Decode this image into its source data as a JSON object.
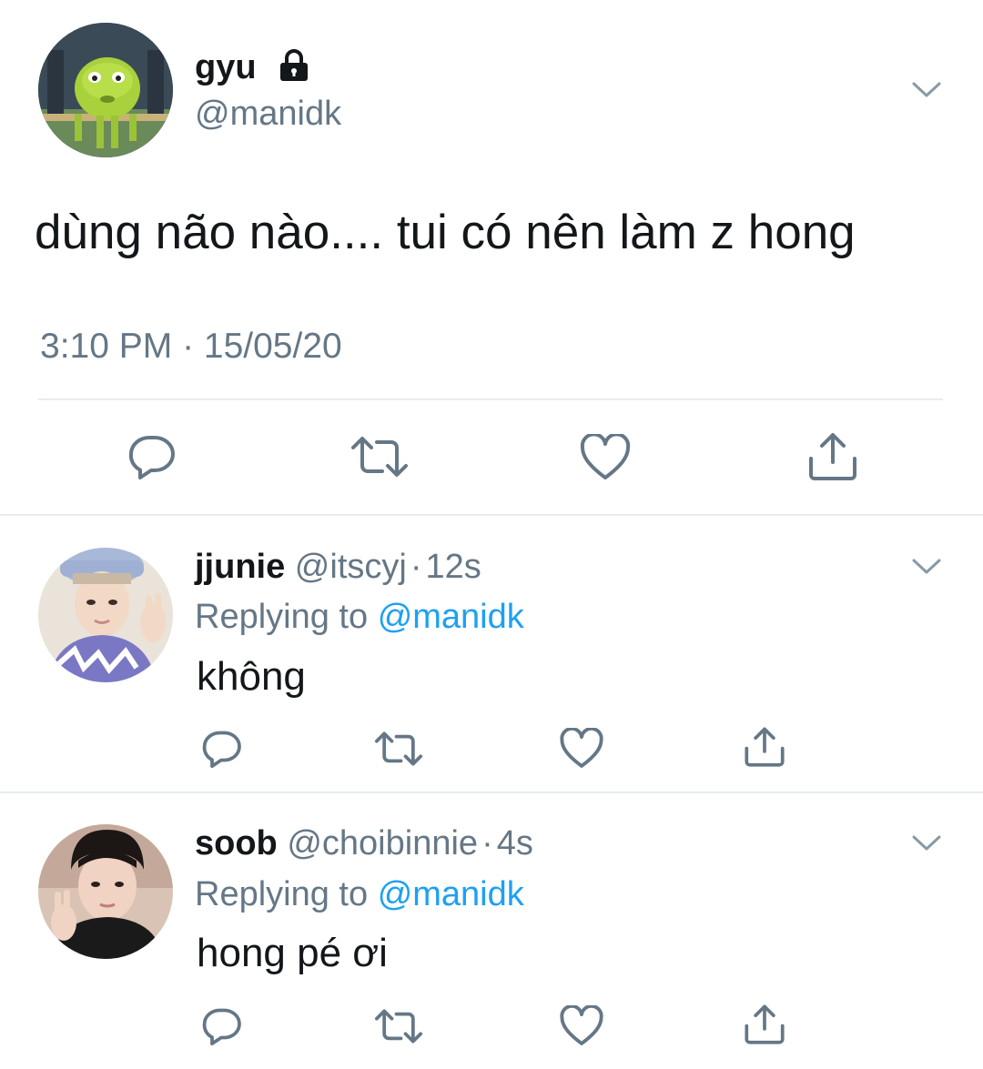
{
  "main_tweet": {
    "author_name": "gyu",
    "author_handle": "@manidk",
    "text": "dùng não nào.... tui có nên làm z hong",
    "timestamp": "3:10 PM · 15/05/20",
    "locked_icon": "lock-icon"
  },
  "actions": {
    "reply_icon": "reply-icon",
    "retweet_icon": "retweet-icon",
    "like_icon": "heart-icon",
    "share_icon": "share-icon"
  },
  "replies": [
    {
      "name": "jjunie",
      "handle": "@itscyj",
      "separator": "·",
      "time": "12s",
      "replying_prefix": "Replying to",
      "replying_to": "@manidk",
      "text": "không"
    },
    {
      "name": "soob",
      "handle": "@choibinnie",
      "separator": "·",
      "time": "4s",
      "replying_prefix": "Replying to",
      "replying_to": "@manidk",
      "text": "hong pé ơi"
    }
  ],
  "colors": {
    "text": "#14171a",
    "muted": "#657786",
    "link": "#1da1f2",
    "divider": "#e6ecf0"
  }
}
